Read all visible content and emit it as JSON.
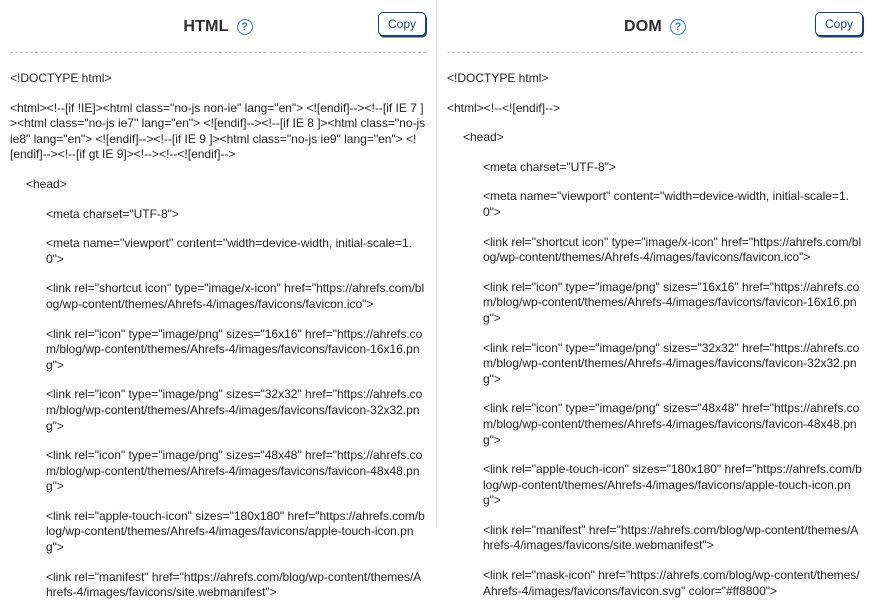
{
  "left": {
    "title": "HTML",
    "copy": "Copy",
    "lines": [
      {
        "cls": "",
        "text": "<!DOCTYPE html>"
      },
      {
        "cls": "",
        "text": "<html><!--[if !IE]><html class=\"no-js non-ie\" lang=\"en\"> <![endif]--><!--[if IE 7 ]><html class=\"no-js ie7\" lang=\"en\"> <![endif]--><!--[if IE 8 ]><html class=\"no-js ie8\" lang=\"en\"> <![endif]--><!--[if IE 9 ]><html class=\"no-js ie9\" lang=\"en\"> <![endif]--><!--[if gt IE 9]><!--><!--<![endif]-->"
      },
      {
        "cls": "ind1",
        "text": "<head>"
      },
      {
        "cls": "ind2",
        "text": "<meta charset=\"UTF-8\">"
      },
      {
        "cls": "ind2",
        "text": "<meta name=\"viewport\" content=\"width=device-width, initial-scale=1.0\">"
      },
      {
        "cls": "ind2",
        "text": "<link rel=\"shortcut icon\" type=\"image/x-icon\" href=\"https://ahrefs.com/blog/wp-content/themes/Ahrefs-4/images/favicons/favicon.ico\">"
      },
      {
        "cls": "ind2",
        "text": "<link rel=\"icon\" type=\"image/png\" sizes=\"16x16\" href=\"https://ahrefs.com/blog/wp-content/themes/Ahrefs-4/images/favicons/favicon-16x16.png\">"
      },
      {
        "cls": "ind2",
        "text": "<link rel=\"icon\" type=\"image/png\" sizes=\"32x32\" href=\"https://ahrefs.com/blog/wp-content/themes/Ahrefs-4/images/favicons/favicon-32x32.png\">"
      },
      {
        "cls": "ind2",
        "text": "<link rel=\"icon\" type=\"image/png\" sizes=\"48x48\" href=\"https://ahrefs.com/blog/wp-content/themes/Ahrefs-4/images/favicons/favicon-48x48.png\">"
      },
      {
        "cls": "ind2",
        "text": "<link rel=\"apple-touch-icon\" sizes=\"180x180\" href=\"https://ahrefs.com/blog/wp-content/themes/Ahrefs-4/images/favicons/apple-touch-icon.png\">"
      },
      {
        "cls": "ind2",
        "text": "<link rel=\"manifest\" href=\"https://ahrefs.com/blog/wp-content/themes/Ahrefs-4/images/favicons/site.webmanifest\">"
      }
    ]
  },
  "right": {
    "title": "DOM",
    "copy": "Copy",
    "lines": [
      {
        "cls": "",
        "text": "<!DOCTYPE html>"
      },
      {
        "cls": "",
        "text": "<html><!--<![endif]-->"
      },
      {
        "cls": "ind1",
        "text": "<head>"
      },
      {
        "cls": "ind2",
        "text": "<meta charset=\"UTF-8\">"
      },
      {
        "cls": "ind2",
        "text": "<meta name=\"viewport\" content=\"width=device-width, initial-scale=1.0\">"
      },
      {
        "cls": "ind2",
        "text": "<link rel=\"shortcut icon\" type=\"image/x-icon\" href=\"https://ahrefs.com/blog/wp-content/themes/Ahrefs-4/images/favicons/favicon.ico\">"
      },
      {
        "cls": "ind2",
        "text": "<link rel=\"icon\" type=\"image/png\" sizes=\"16x16\" href=\"https://ahrefs.com/blog/wp-content/themes/Ahrefs-4/images/favicons/favicon-16x16.png\">"
      },
      {
        "cls": "ind2",
        "text": "<link rel=\"icon\" type=\"image/png\" sizes=\"32x32\" href=\"https://ahrefs.com/blog/wp-content/themes/Ahrefs-4/images/favicons/favicon-32x32.png\">"
      },
      {
        "cls": "ind2",
        "text": "<link rel=\"icon\" type=\"image/png\" sizes=\"48x48\" href=\"https://ahrefs.com/blog/wp-content/themes/Ahrefs-4/images/favicons/favicon-48x48.png\">"
      },
      {
        "cls": "ind2",
        "text": "<link rel=\"apple-touch-icon\" sizes=\"180x180\" href=\"https://ahrefs.com/blog/wp-content/themes/Ahrefs-4/images/favicons/apple-touch-icon.png\">"
      },
      {
        "cls": "ind2",
        "text": "<link rel=\"manifest\" href=\"https://ahrefs.com/blog/wp-content/themes/Ahrefs-4/images/favicons/site.webmanifest\">"
      },
      {
        "cls": "ind2",
        "text": "<link rel=\"mask-icon\" href=\"https://ahrefs.com/blog/wp-content/themes/Ahrefs-4/images/favicons/favicon.svg\" color=\"#ff8800\">"
      }
    ]
  }
}
